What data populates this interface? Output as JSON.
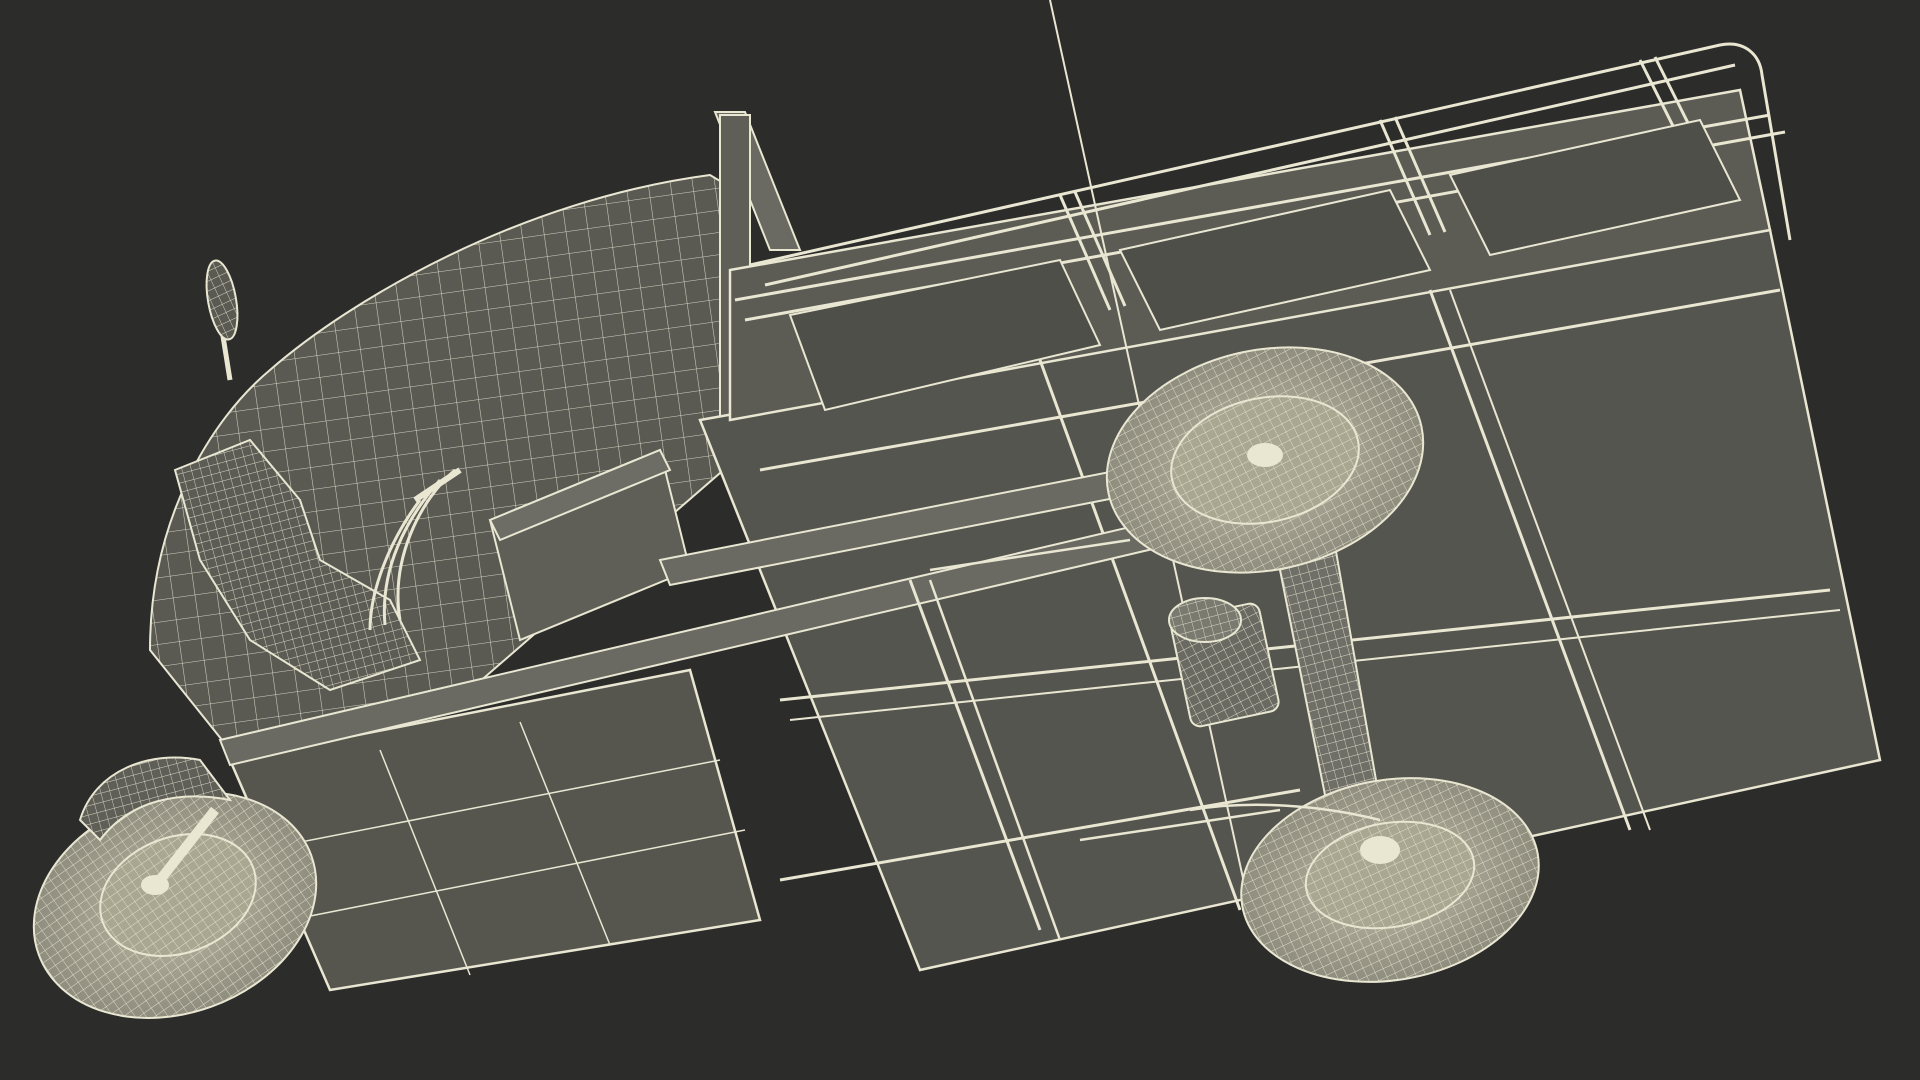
{
  "colors": {
    "background": "#2c2c2b",
    "panel": "#55554f",
    "panel_light": "#66665f",
    "panel_dark": "#474742",
    "wire": "#e9e6d2",
    "wire_dim": "#c9c6b0"
  },
  "scene": {
    "subject": "wireframe-cargo-tricycle-underside"
  }
}
